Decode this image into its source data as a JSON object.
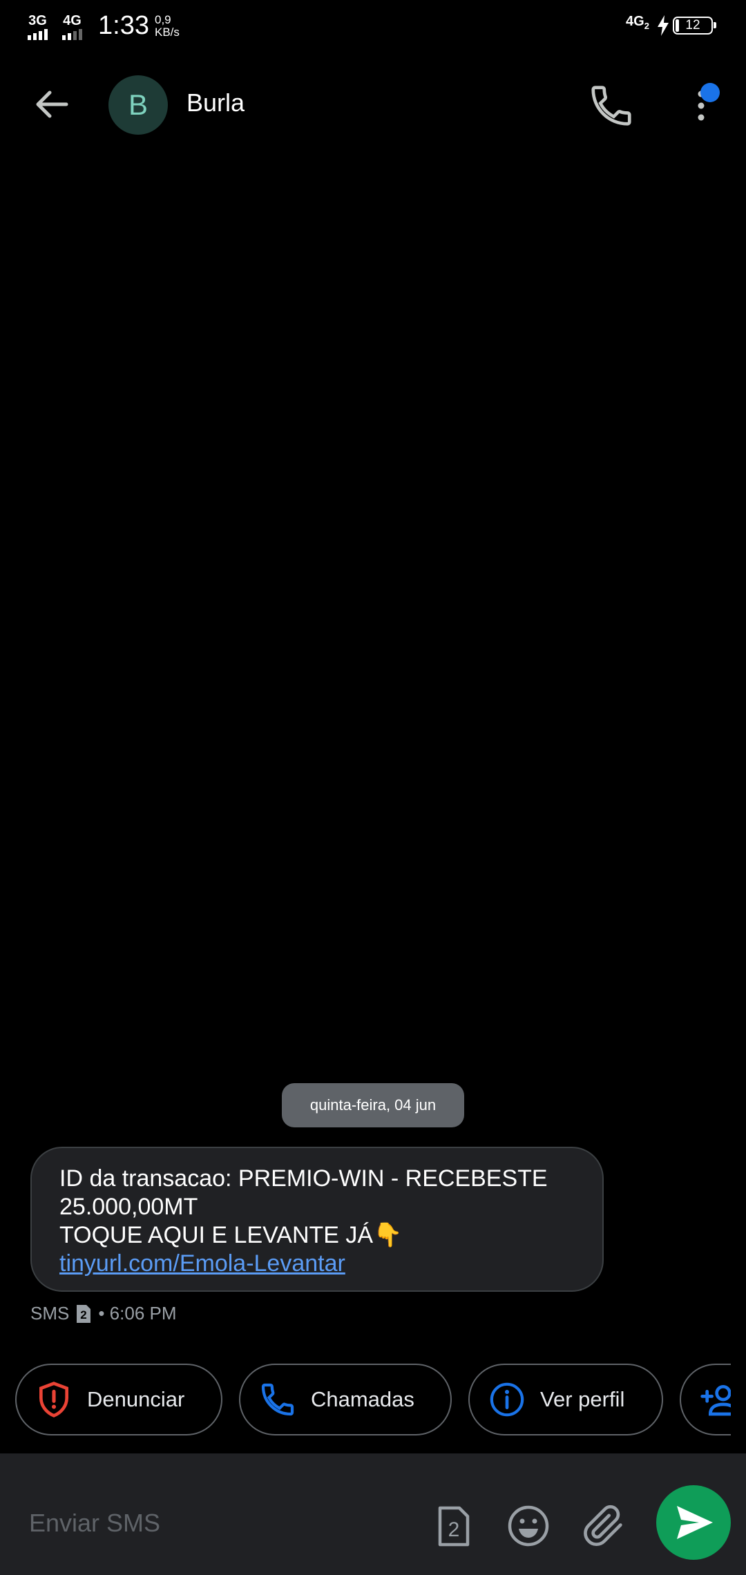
{
  "status_bar": {
    "net1": "3G",
    "net2": "4G",
    "time": "1:33",
    "speed_value": "0,9",
    "speed_unit": "KB/s",
    "net3": "4G",
    "net3_sub": "2",
    "battery_level": "12"
  },
  "contact": {
    "initial": "B",
    "name": "Burla",
    "avatar_color": "#1e3b36"
  },
  "conversation": {
    "date_chip": "quinta-feira, 04 jun",
    "message": {
      "lines": [
        "ID da transacao: PREMIO-WIN - RECEBESTE",
        "25.000,00MT",
        "TOQUE AQUI E LEVANTE JÁ👇"
      ],
      "link": "tinyurl.com/Emola-Levantar"
    },
    "meta": {
      "channel": "SMS",
      "sim": "2",
      "time": "• 6:06 PM"
    }
  },
  "suggestions": [
    {
      "label": "Denunciar",
      "icon": "shield-alert-icon",
      "color": "#ea4335"
    },
    {
      "label": "Chamadas",
      "icon": "phone-icon",
      "color": "#1a73e8"
    },
    {
      "label": "Ver perfil",
      "icon": "info-icon",
      "color": "#1a73e8"
    },
    {
      "label": "",
      "icon": "add-contact-icon",
      "color": "#1a73e8"
    }
  ],
  "compose": {
    "placeholder": "Enviar SMS",
    "sim": "2"
  },
  "colors": {
    "accent": "#1a73e8",
    "send": "#0f9d58",
    "link": "#5b9cf5"
  }
}
